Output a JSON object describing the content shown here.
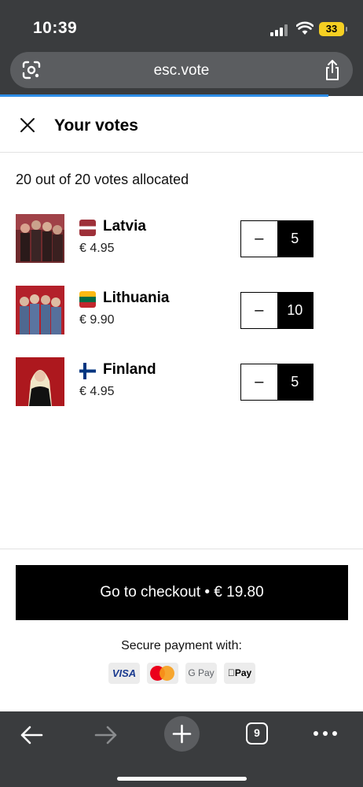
{
  "status": {
    "time": "10:39",
    "battery": "33"
  },
  "browser": {
    "url": "esc.vote",
    "tab_count": "9"
  },
  "header": {
    "title": "Your votes"
  },
  "summary": {
    "allocated_text": "20 out of 20 votes allocated"
  },
  "votes": [
    {
      "country": "Latvia",
      "price": "€ 4.95",
      "count": "5",
      "minus": "–"
    },
    {
      "country": "Lithuania",
      "price": "€ 9.90",
      "count": "10",
      "minus": "–"
    },
    {
      "country": "Finland",
      "price": "€ 4.95",
      "count": "5",
      "minus": "–"
    }
  ],
  "checkout": {
    "label": "Go to checkout • € 19.80"
  },
  "payment": {
    "label": "Secure payment with:",
    "methods": [
      "VISA",
      "G Pay",
      "Pay"
    ]
  },
  "colors": {
    "chrome": "#3a3c3e",
    "accent": "#2e8ee8",
    "button": "#000000"
  }
}
